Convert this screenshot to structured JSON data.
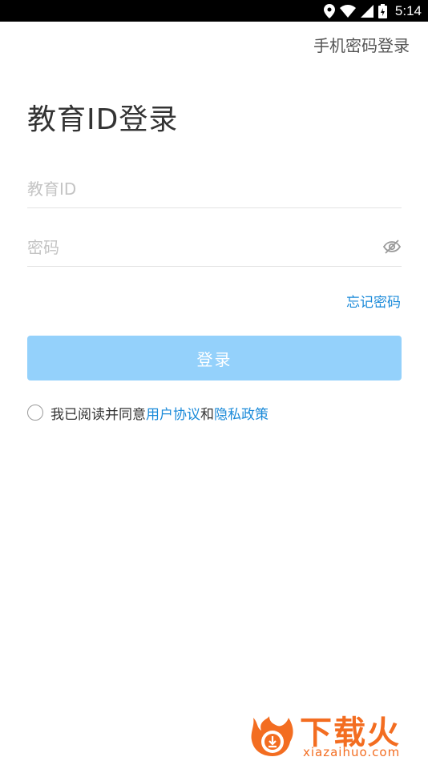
{
  "status_bar": {
    "time": "5:14",
    "icons": [
      "location-icon",
      "wifi-icon",
      "signal-icon",
      "battery-icon"
    ]
  },
  "header": {
    "switch_link": "手机密码登录"
  },
  "main": {
    "title": "教育ID登录",
    "id_field": {
      "placeholder": "教育ID",
      "value": ""
    },
    "password_field": {
      "placeholder": "密码",
      "value": ""
    },
    "forgot_link": "忘记密码",
    "login_button": "登录",
    "agreement": {
      "checked": false,
      "text_prefix": "我已阅读并同意",
      "user_agreement": "用户协议",
      "conjunction": "和",
      "privacy_policy": "隐私政策"
    }
  },
  "watermark": {
    "brand": "下载火",
    "url": "xiazaihuo.com"
  },
  "colors": {
    "accent": "#1a8ad9",
    "button_disabled": "#94d1fb",
    "watermark": "#f36d21"
  }
}
